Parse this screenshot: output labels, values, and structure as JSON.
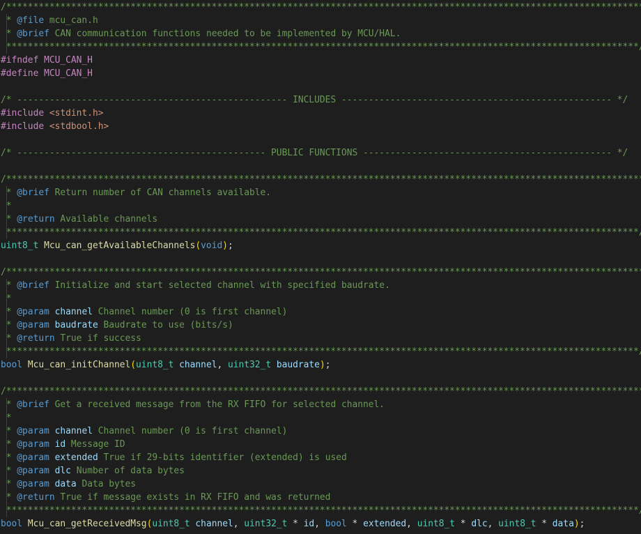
{
  "lines": [
    [
      {
        "c": "cmt",
        "t": "/***********************************************************************************************************************"
      }
    ],
    [
      {
        "g": 1
      },
      {
        "c": "cmt",
        "t": " * "
      },
      {
        "c": "tag",
        "t": "@file"
      },
      {
        "c": "cmt",
        "t": " mcu_can.h"
      }
    ],
    [
      {
        "g": 1
      },
      {
        "c": "cmt",
        "t": " * "
      },
      {
        "c": "tag",
        "t": "@brief"
      },
      {
        "c": "cmt",
        "t": " CAN communication functions needed to be implemented by MCU/HAL."
      }
    ],
    [
      {
        "g": 1
      },
      {
        "c": "cmt",
        "t": " *********************************************************************************************************************/"
      }
    ],
    [
      {
        "c": "pp",
        "t": "#ifndef"
      },
      {
        "c": "txt",
        "t": " "
      },
      {
        "c": "mac",
        "t": "MCU_CAN_H"
      }
    ],
    [
      {
        "c": "pp",
        "t": "#define"
      },
      {
        "c": "txt",
        "t": " "
      },
      {
        "c": "mac",
        "t": "MCU_CAN_H"
      }
    ],
    [],
    [
      {
        "c": "cmt",
        "t": "/* -------------------------------------------------- INCLUDES -------------------------------------------------- */"
      }
    ],
    [
      {
        "c": "pp",
        "t": "#include"
      },
      {
        "c": "txt",
        "t": " "
      },
      {
        "c": "str",
        "t": "<stdint.h>"
      }
    ],
    [
      {
        "c": "pp",
        "t": "#include"
      },
      {
        "c": "txt",
        "t": " "
      },
      {
        "c": "str",
        "t": "<stdbool.h>"
      }
    ],
    [],
    [
      {
        "c": "cmt",
        "t": "/* ---------------------------------------------- PUBLIC FUNCTIONS ---------------------------------------------- */"
      }
    ],
    [],
    [
      {
        "c": "cmt",
        "t": "/***********************************************************************************************************************"
      }
    ],
    [
      {
        "g": 1
      },
      {
        "c": "cmt",
        "t": " * "
      },
      {
        "c": "tag",
        "t": "@brief"
      },
      {
        "c": "cmt",
        "t": " Return number of CAN channels available."
      }
    ],
    [
      {
        "g": 1
      },
      {
        "c": "cmt",
        "t": " *"
      }
    ],
    [
      {
        "g": 1
      },
      {
        "c": "cmt",
        "t": " * "
      },
      {
        "c": "tag",
        "t": "@return"
      },
      {
        "c": "cmt",
        "t": " Available channels"
      }
    ],
    [
      {
        "g": 1
      },
      {
        "c": "cmt",
        "t": " *********************************************************************************************************************/"
      }
    ],
    [
      {
        "c": "typ",
        "t": "uint8_t"
      },
      {
        "c": "txt",
        "t": " "
      },
      {
        "c": "fn",
        "t": "Mcu_can_getAvailableChannels"
      },
      {
        "c": "br1",
        "t": "("
      },
      {
        "c": "kw",
        "t": "void"
      },
      {
        "c": "br1",
        "t": ")"
      },
      {
        "c": "txt",
        "t": ";"
      }
    ],
    [],
    [
      {
        "c": "cmt",
        "t": "/***********************************************************************************************************************"
      }
    ],
    [
      {
        "g": 1
      },
      {
        "c": "cmt",
        "t": " * "
      },
      {
        "c": "tag",
        "t": "@brief"
      },
      {
        "c": "cmt",
        "t": " Initialize and start selected channel with specified baudrate."
      }
    ],
    [
      {
        "g": 1
      },
      {
        "c": "cmt",
        "t": " *"
      }
    ],
    [
      {
        "g": 1
      },
      {
        "c": "cmt",
        "t": " * "
      },
      {
        "c": "tag",
        "t": "@param"
      },
      {
        "c": "cmt",
        "t": " "
      },
      {
        "c": "par-in-cmt",
        "t": "channel"
      },
      {
        "c": "cmt",
        "t": " Channel number (0 is first channel)"
      }
    ],
    [
      {
        "g": 1
      },
      {
        "c": "cmt",
        "t": " * "
      },
      {
        "c": "tag",
        "t": "@param"
      },
      {
        "c": "cmt",
        "t": " "
      },
      {
        "c": "par-in-cmt",
        "t": "baudrate"
      },
      {
        "c": "cmt",
        "t": " Baudrate to use (bits/s)"
      }
    ],
    [
      {
        "g": 1
      },
      {
        "c": "cmt",
        "t": " * "
      },
      {
        "c": "tag",
        "t": "@return"
      },
      {
        "c": "cmt",
        "t": " True if success"
      }
    ],
    [
      {
        "g": 1
      },
      {
        "c": "cmt",
        "t": " *********************************************************************************************************************/"
      }
    ],
    [
      {
        "c": "kw",
        "t": "bool"
      },
      {
        "c": "txt",
        "t": " "
      },
      {
        "c": "fn",
        "t": "Mcu_can_initChannel"
      },
      {
        "c": "br1",
        "t": "("
      },
      {
        "c": "typ",
        "t": "uint8_t"
      },
      {
        "c": "txt",
        "t": " "
      },
      {
        "c": "par",
        "t": "channel"
      },
      {
        "c": "txt",
        "t": ", "
      },
      {
        "c": "typ",
        "t": "uint32_t"
      },
      {
        "c": "txt",
        "t": " "
      },
      {
        "c": "par",
        "t": "baudrate"
      },
      {
        "c": "br1",
        "t": ")"
      },
      {
        "c": "txt",
        "t": ";"
      }
    ],
    [],
    [
      {
        "c": "cmt",
        "t": "/***********************************************************************************************************************"
      }
    ],
    [
      {
        "g": 1
      },
      {
        "c": "cmt",
        "t": " * "
      },
      {
        "c": "tag",
        "t": "@brief"
      },
      {
        "c": "cmt",
        "t": " Get a received message from the RX FIFO for selected channel."
      }
    ],
    [
      {
        "g": 1
      },
      {
        "c": "cmt",
        "t": " *"
      }
    ],
    [
      {
        "g": 1
      },
      {
        "c": "cmt",
        "t": " * "
      },
      {
        "c": "tag",
        "t": "@param"
      },
      {
        "c": "cmt",
        "t": " "
      },
      {
        "c": "par-in-cmt",
        "t": "channel"
      },
      {
        "c": "cmt",
        "t": " Channel number (0 is first channel)"
      }
    ],
    [
      {
        "g": 1
      },
      {
        "c": "cmt",
        "t": " * "
      },
      {
        "c": "tag",
        "t": "@param"
      },
      {
        "c": "cmt",
        "t": " "
      },
      {
        "c": "par-in-cmt",
        "t": "id"
      },
      {
        "c": "cmt",
        "t": " Message ID"
      }
    ],
    [
      {
        "g": 1
      },
      {
        "c": "cmt",
        "t": " * "
      },
      {
        "c": "tag",
        "t": "@param"
      },
      {
        "c": "cmt",
        "t": " "
      },
      {
        "c": "par-in-cmt",
        "t": "extended"
      },
      {
        "c": "cmt",
        "t": " True if 29-bits identifier (extended) is used"
      }
    ],
    [
      {
        "g": 1
      },
      {
        "c": "cmt",
        "t": " * "
      },
      {
        "c": "tag",
        "t": "@param"
      },
      {
        "c": "cmt",
        "t": " "
      },
      {
        "c": "par-in-cmt",
        "t": "dlc"
      },
      {
        "c": "cmt",
        "t": " Number of data bytes"
      }
    ],
    [
      {
        "g": 1
      },
      {
        "c": "cmt",
        "t": " * "
      },
      {
        "c": "tag",
        "t": "@param"
      },
      {
        "c": "cmt",
        "t": " "
      },
      {
        "c": "par-in-cmt",
        "t": "data"
      },
      {
        "c": "cmt",
        "t": " Data bytes"
      }
    ],
    [
      {
        "g": 1
      },
      {
        "c": "cmt",
        "t": " * "
      },
      {
        "c": "tag",
        "t": "@return"
      },
      {
        "c": "cmt",
        "t": " True if message exists in RX FIFO and was returned"
      }
    ],
    [
      {
        "g": 1
      },
      {
        "c": "cmt",
        "t": " *********************************************************************************************************************/"
      }
    ],
    [
      {
        "c": "kw",
        "t": "bool"
      },
      {
        "c": "txt",
        "t": " "
      },
      {
        "c": "fn",
        "t": "Mcu_can_getReceivedMsg"
      },
      {
        "c": "br1",
        "t": "("
      },
      {
        "c": "typ",
        "t": "uint8_t"
      },
      {
        "c": "txt",
        "t": " "
      },
      {
        "c": "par",
        "t": "channel"
      },
      {
        "c": "txt",
        "t": ", "
      },
      {
        "c": "typ",
        "t": "uint32_t"
      },
      {
        "c": "txt",
        "t": " * "
      },
      {
        "c": "par",
        "t": "id"
      },
      {
        "c": "txt",
        "t": ", "
      },
      {
        "c": "kw",
        "t": "bool"
      },
      {
        "c": "txt",
        "t": " * "
      },
      {
        "c": "par",
        "t": "extended"
      },
      {
        "c": "txt",
        "t": ", "
      },
      {
        "c": "typ",
        "t": "uint8_t"
      },
      {
        "c": "txt",
        "t": " * "
      },
      {
        "c": "par",
        "t": "dlc"
      },
      {
        "c": "txt",
        "t": ", "
      },
      {
        "c": "typ",
        "t": "uint8_t"
      },
      {
        "c": "txt",
        "t": " * "
      },
      {
        "c": "par",
        "t": "data"
      },
      {
        "c": "br1",
        "t": ")"
      },
      {
        "c": "txt",
        "t": ";"
      }
    ]
  ]
}
